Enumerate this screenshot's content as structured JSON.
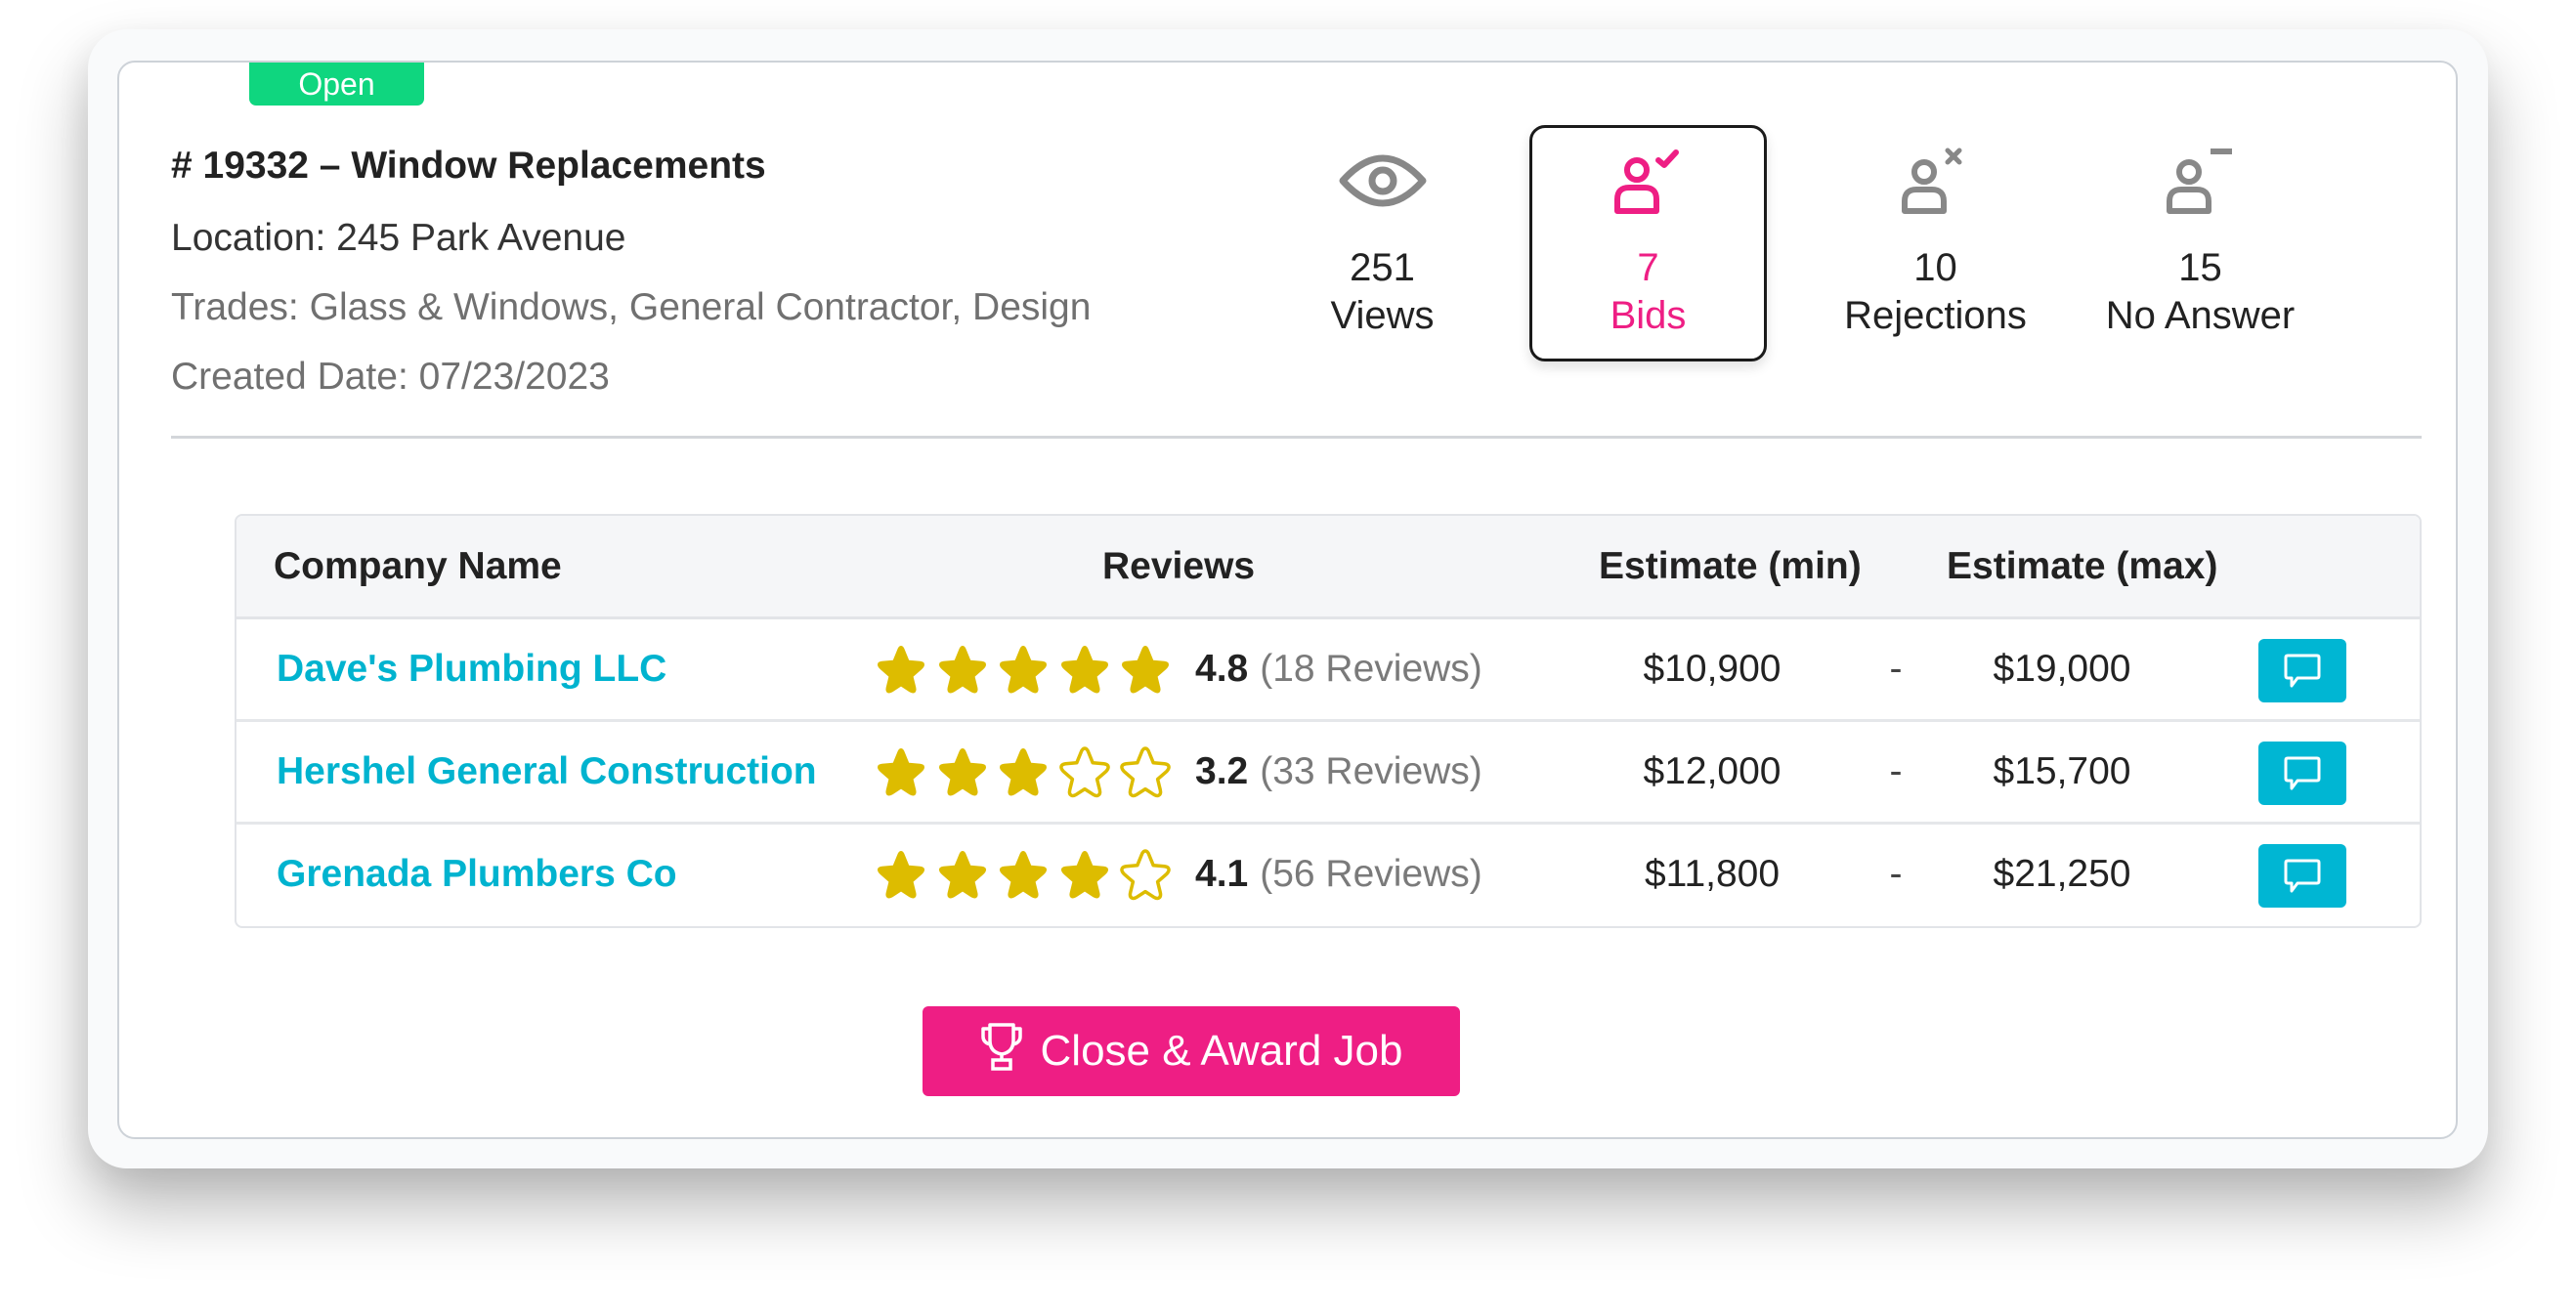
{
  "job": {
    "status": "Open",
    "title": "# 19332 – Window Replacements",
    "location": "Location: 245 Park Avenue",
    "trades": "Trades: Glass & Windows, General Contractor, Design",
    "created": "Created Date: 07/23/2023"
  },
  "stats": [
    {
      "icon": "eye-icon",
      "value": "251",
      "label": "Views",
      "active": false
    },
    {
      "icon": "user-check-icon",
      "value": "7",
      "label": "Bids",
      "active": true
    },
    {
      "icon": "user-x-icon",
      "value": "10",
      "label": "Rejections",
      "active": false
    },
    {
      "icon": "user-minus-icon",
      "value": "15",
      "label": "No Answer",
      "active": false
    }
  ],
  "table": {
    "headers": {
      "company": "Company Name",
      "reviews": "Reviews",
      "est_min": "Estimate (min)",
      "est_max": "Estimate (max)"
    },
    "rows": [
      {
        "company": "Dave's Plumbing LLC",
        "stars_filled": 5,
        "rating": "4.8",
        "reviews": "(18 Reviews)",
        "est_min": "$10,900",
        "separator": "-",
        "est_max": "$19,000"
      },
      {
        "company": "Hershel General Construction",
        "stars_filled": 3,
        "rating": "3.2",
        "reviews": "(33 Reviews)",
        "est_min": "$12,000",
        "separator": "-",
        "est_max": "$15,700"
      },
      {
        "company": "Grenada Plumbers Co",
        "stars_filled": 4,
        "rating": "4.1",
        "reviews": "(56 Reviews)",
        "est_min": "$11,800",
        "separator": "-",
        "est_max": "$21,250"
      }
    ]
  },
  "award_button": {
    "label": "Close & Award Job",
    "icon": "trophy-icon"
  },
  "colors": {
    "accent_pink": "#EE1E84",
    "link_cyan": "#00B3CF",
    "chat_button": "#00B6D3",
    "star_gold": "#DDBC00",
    "status_green": "#0FD67F",
    "icon_gray": "#888888"
  }
}
